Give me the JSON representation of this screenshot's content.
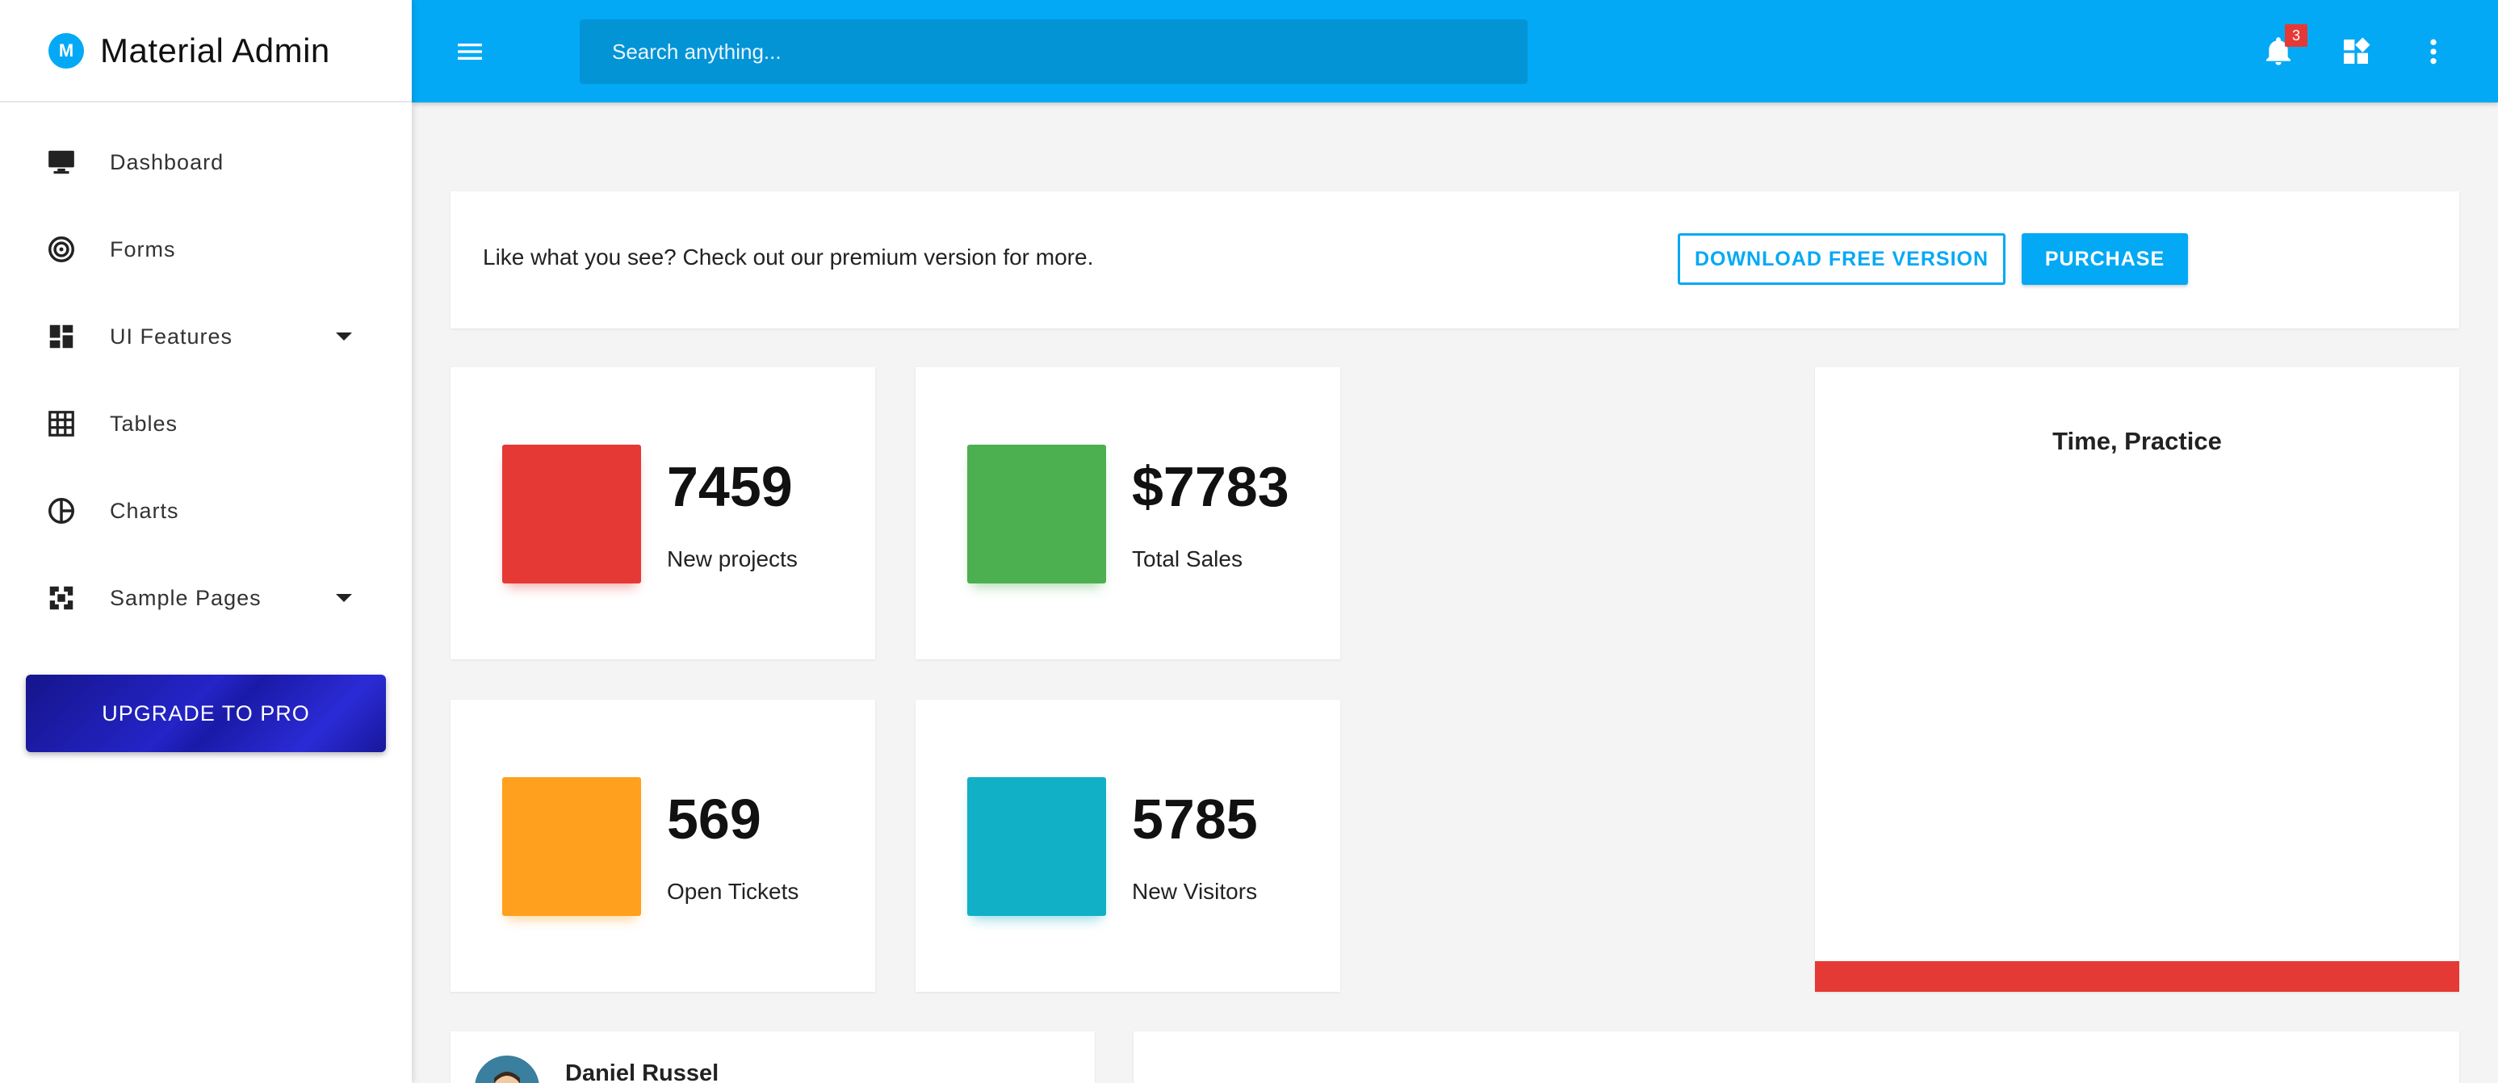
{
  "brand": {
    "logo_letter": "M",
    "name": "Material Admin"
  },
  "sidebar": {
    "items": [
      {
        "label": "Dashboard",
        "icon": "monitor-icon"
      },
      {
        "label": "Forms",
        "icon": "target-icon"
      },
      {
        "label": "UI Features",
        "icon": "dashboard-grid-icon",
        "expandable": true
      },
      {
        "label": "Tables",
        "icon": "table-grid-icon"
      },
      {
        "label": "Charts",
        "icon": "pie-chart-icon"
      },
      {
        "label": "Sample Pages",
        "icon": "pages-icon",
        "expandable": true
      }
    ],
    "upgrade_label": "UPGRADE TO PRO"
  },
  "topbar": {
    "search_placeholder": "Search anything...",
    "notification_count": "3"
  },
  "promo": {
    "text": "Like what you see? Check out our premium version for more.",
    "download_label": "DOWNLOAD FREE VERSION",
    "purchase_label": "PURCHASE"
  },
  "stats": [
    {
      "value": "7459",
      "label": "New projects",
      "color": "#e53935"
    },
    {
      "value": "$7783",
      "label": "Total Sales",
      "color": "#4caf50"
    },
    {
      "value": "569",
      "label": "Open Tickets",
      "color": "#ffa01f"
    },
    {
      "value": "5785",
      "label": "New Visitors",
      "color": "#12b0c6"
    }
  ],
  "chart": {
    "title": "Time, Practice",
    "accent": "#e53935"
  },
  "profile": {
    "name": "Daniel Russel"
  },
  "colors": {
    "primary": "#03a9f4",
    "upgrade": "#1f1fb8"
  }
}
